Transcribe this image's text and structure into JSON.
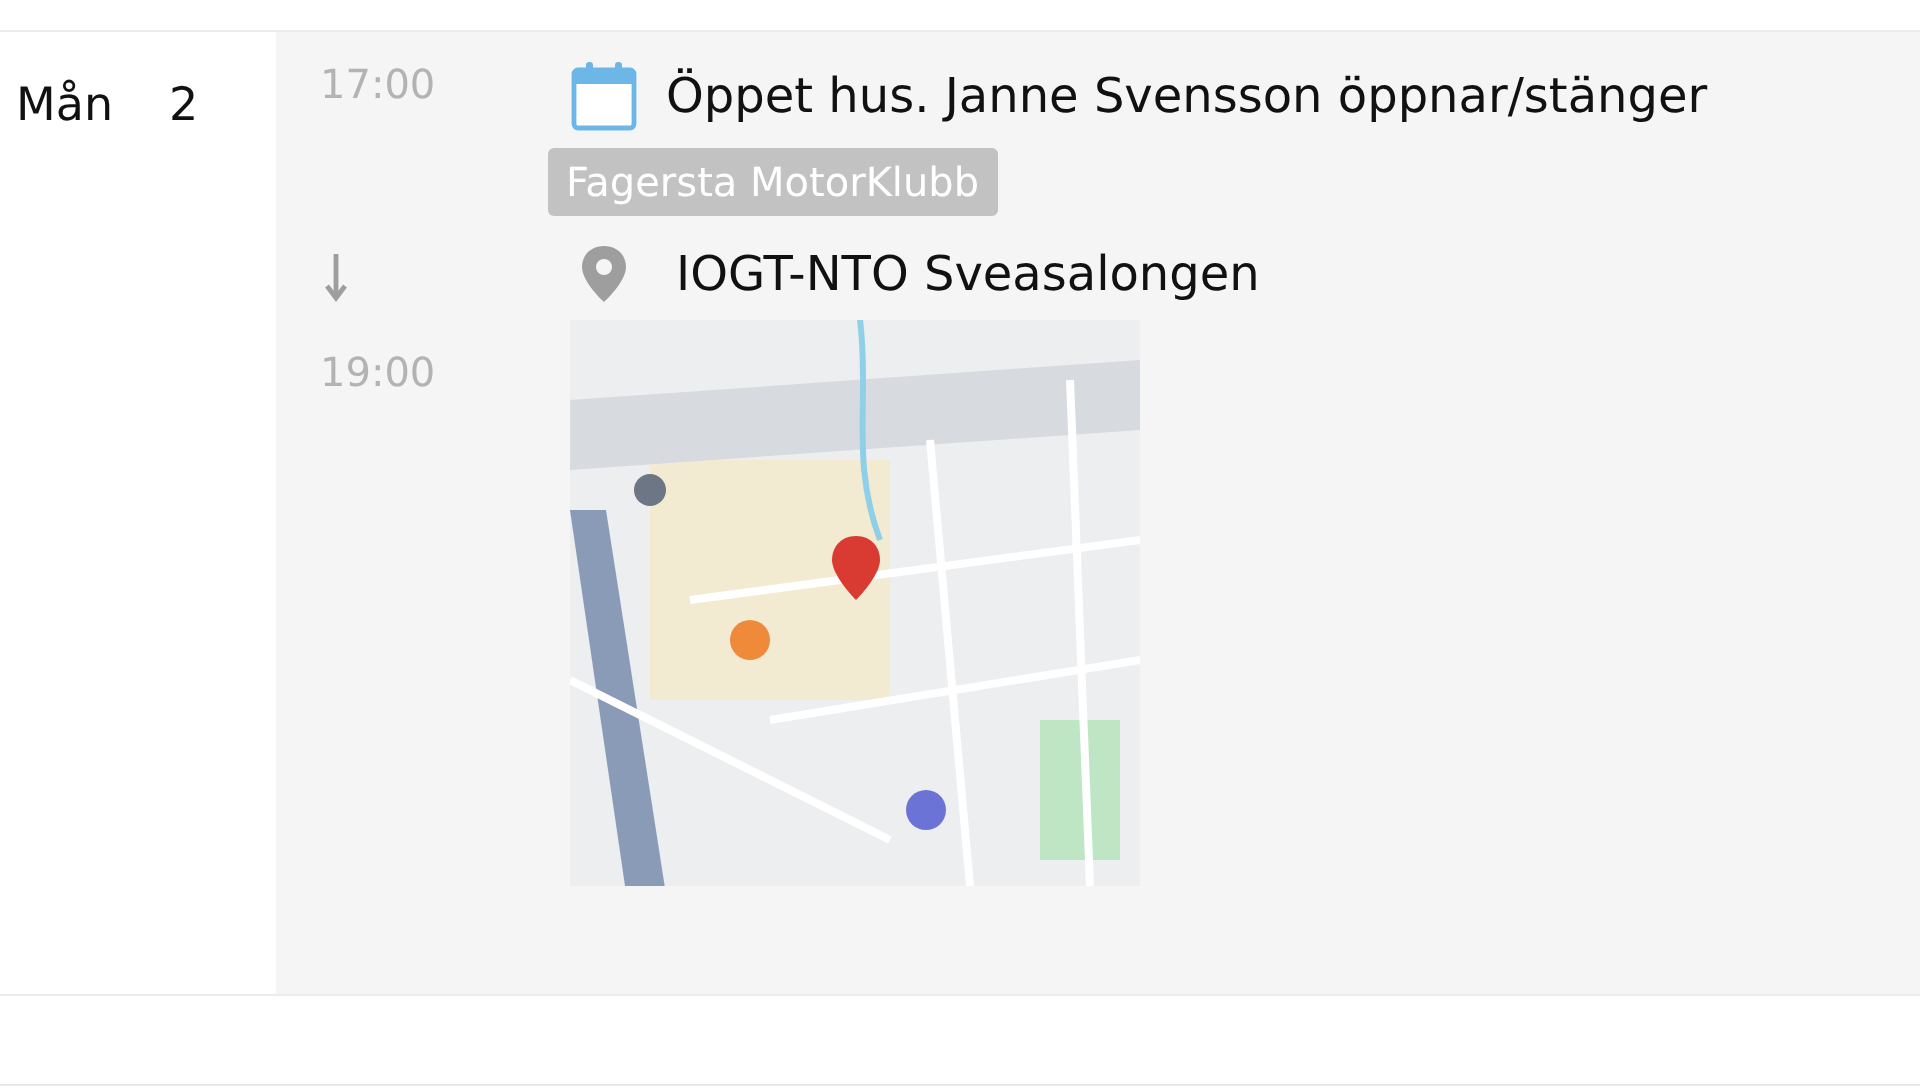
{
  "day": {
    "weekday": "Mån",
    "date": "2"
  },
  "event": {
    "start_time": "17:00",
    "end_time": "19:00",
    "title": "Öppet hus. Janne Svensson öppnar/stänger",
    "organizer": "Fagersta MotorKlubb",
    "location": "IOGT-NTO Sveasalongen"
  }
}
